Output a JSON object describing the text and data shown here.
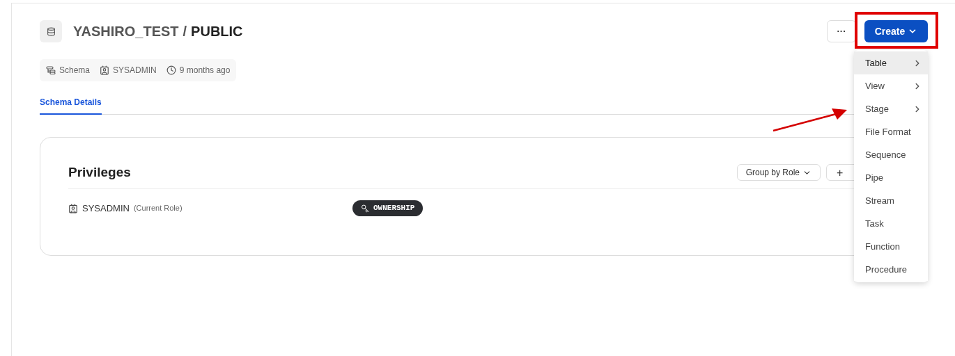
{
  "header": {
    "database": "YASHIRO_TEST",
    "separator": "/",
    "schema": "PUBLIC"
  },
  "meta": [
    {
      "kind": "type",
      "text": "Schema"
    },
    {
      "kind": "owner",
      "text": "SYSADMIN"
    },
    {
      "kind": "time",
      "text": "9 months ago"
    }
  ],
  "tabs": [
    {
      "label": "Schema Details",
      "selected": true
    }
  ],
  "actions": {
    "more": "···",
    "create": "Create"
  },
  "privileges": {
    "title": "Privileges",
    "group_by": "Group by Role",
    "add": "+",
    "rows": [
      {
        "role": "SYSADMIN",
        "note": "(Current Role)",
        "privilege": "OWNERSHIP"
      }
    ]
  },
  "create_menu": [
    {
      "label": "Table",
      "submenu": true,
      "selected": true
    },
    {
      "label": "View",
      "submenu": true,
      "selected": false
    },
    {
      "label": "Stage",
      "submenu": true,
      "selected": false
    },
    {
      "label": "File Format",
      "submenu": false,
      "selected": false
    },
    {
      "label": "Sequence",
      "submenu": false,
      "selected": false
    },
    {
      "label": "Pipe",
      "submenu": false,
      "selected": false
    },
    {
      "label": "Stream",
      "submenu": false,
      "selected": false
    },
    {
      "label": "Task",
      "submenu": false,
      "selected": false
    },
    {
      "label": "Function",
      "submenu": false,
      "selected": false
    },
    {
      "label": "Procedure",
      "submenu": false,
      "selected": false
    }
  ]
}
